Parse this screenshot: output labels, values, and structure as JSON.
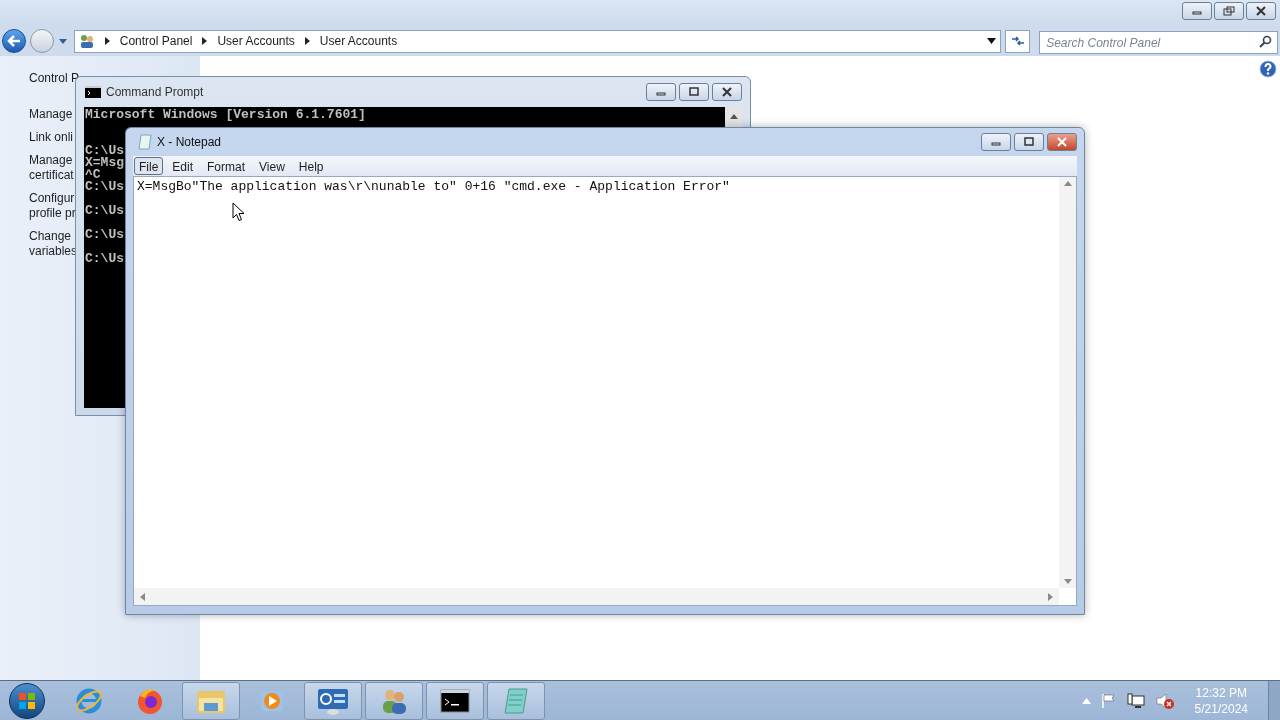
{
  "explorer": {
    "breadcrumbs": [
      "Control Panel",
      "User Accounts",
      "User Accounts"
    ],
    "search": {
      "placeholder": "Search Control Panel"
    },
    "sidebar": [
      {
        "lines": [
          "Control P"
        ]
      },
      {
        "lines": [
          "Manage"
        ]
      },
      {
        "lines": [
          "Link onli"
        ]
      },
      {
        "lines": [
          "Manage",
          "certificat"
        ]
      },
      {
        "lines": [
          "Configur",
          "profile pr"
        ]
      },
      {
        "lines": [
          "Change",
          "variables"
        ]
      }
    ]
  },
  "command_prompt": {
    "title": "Command Prompt",
    "lines": [
      {
        "kind": "text",
        "text": "Microsoft Windows [Version 6.1.7601]"
      },
      {
        "kind": "blank"
      },
      {
        "kind": "blank"
      },
      {
        "kind": "text",
        "text": "C:\\Us"
      },
      {
        "kind": "text",
        "text": "X=Msg"
      },
      {
        "kind": "text",
        "text": "^C"
      },
      {
        "kind": "text",
        "text": "C:\\Us"
      },
      {
        "kind": "blank"
      },
      {
        "kind": "text",
        "text": "C:\\Us"
      },
      {
        "kind": "blank"
      },
      {
        "kind": "text",
        "text": "C:\\Us"
      },
      {
        "kind": "blank"
      },
      {
        "kind": "text",
        "text": "C:\\Us"
      }
    ]
  },
  "notepad": {
    "title": "X - Notepad",
    "menu": [
      {
        "label": "File",
        "selected": true
      },
      {
        "label": "Edit",
        "selected": false
      },
      {
        "label": "Format",
        "selected": false
      },
      {
        "label": "View",
        "selected": false
      },
      {
        "label": "Help",
        "selected": false
      }
    ],
    "text": "X=MsgBo\"The application was\\r\\nunable to\" 0+16 \"cmd.exe - Application Error\""
  },
  "taskbar": {
    "items": [
      {
        "kind": "ie",
        "running": false
      },
      {
        "kind": "firefox",
        "running": false
      },
      {
        "kind": "folder",
        "running": true
      },
      {
        "kind": "media",
        "running": false
      },
      {
        "kind": "control-panel",
        "running": true
      },
      {
        "kind": "users",
        "running": true
      },
      {
        "kind": "cmd",
        "running": true
      },
      {
        "kind": "notepad",
        "running": true
      }
    ],
    "time": "12:32 PM",
    "date": "5/21/2024"
  }
}
